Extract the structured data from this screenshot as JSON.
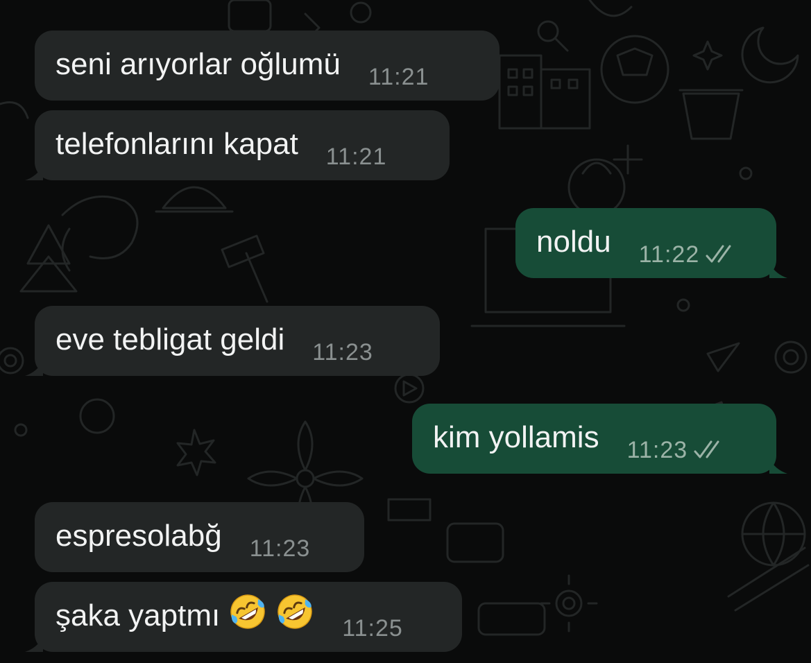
{
  "chat": {
    "colors": {
      "background": "#0a0b0b",
      "incoming_bubble": "#232626",
      "outgoing_bubble": "#174c37",
      "text": "#f2f3f3",
      "time_incoming": "#8a9090",
      "time_outgoing": "#9bb3a7"
    },
    "messages": [
      {
        "direction": "incoming",
        "text": "seni arıyorlar oğlumü",
        "time": "11:21"
      },
      {
        "direction": "incoming",
        "text": "telefonlarını kapat",
        "time": "11:21"
      },
      {
        "direction": "outgoing",
        "text": "noldu",
        "time": "11:22",
        "status_icon": "double-check-icon"
      },
      {
        "direction": "incoming",
        "text": "eve tebligat geldi",
        "time": "11:23"
      },
      {
        "direction": "outgoing",
        "text": "kim yollamis",
        "time": "11:23",
        "status_icon": "double-check-icon"
      },
      {
        "direction": "incoming",
        "text": "espresolabğ",
        "time": "11:23"
      },
      {
        "direction": "incoming",
        "text": "şaka yaptmı",
        "time": "11:25",
        "emoji": [
          "rolling-on-floor-laughing-emoji",
          "rolling-on-floor-laughing-emoji"
        ]
      }
    ]
  }
}
